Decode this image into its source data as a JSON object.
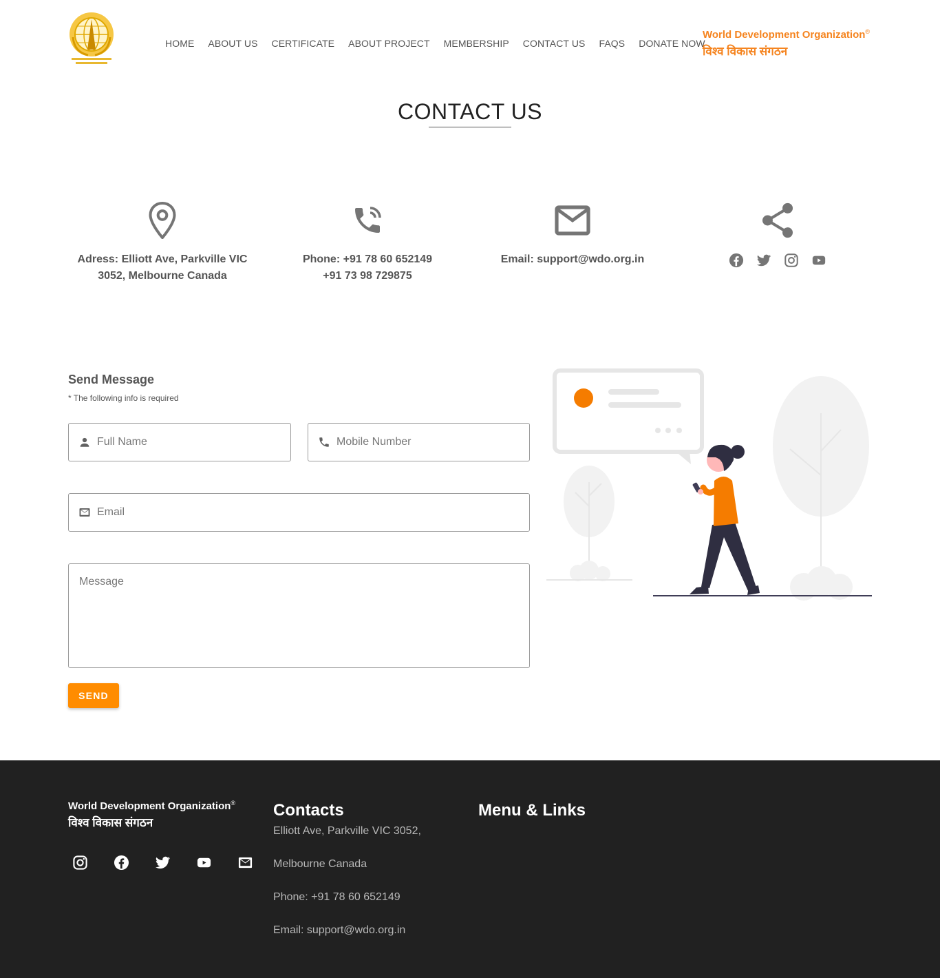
{
  "header": {
    "logo_alt": "World Development Organization",
    "nav": [
      "HOME",
      "ABOUT US",
      "CERTIFICATE",
      "ABOUT PROJECT",
      "MEMBERSHIP",
      "CONTACT US",
      "FAQS",
      "DONATE NOW"
    ],
    "brand_en": "World Development Organization",
    "brand_reg": "®",
    "brand_hi": "विश्व विकास संगठन"
  },
  "page": {
    "title": "CONTACT US"
  },
  "info": {
    "address_line1": "Adress: Elliott Ave, Parkville VIC",
    "address_line2": "3052, Melbourne Canada",
    "phone_line1": "Phone: +91 78 60 652149",
    "phone_line2": "+91 73 98 729875",
    "email": "Email: support@wdo.org.in",
    "social_icons": [
      "facebook-icon",
      "twitter-icon",
      "instagram-icon",
      "youtube-icon"
    ]
  },
  "form": {
    "title": "Send Message",
    "note": "* The following info is required",
    "name_placeholder": "Full Name",
    "mobile_placeholder": "Mobile Number",
    "email_placeholder": "Email",
    "message_placeholder": "Message",
    "send_label": "SEND"
  },
  "footer": {
    "brand_en": "World Development Organization",
    "brand_reg": "®",
    "brand_hi": "विश्व विकास संगठन",
    "social_icons": [
      "instagram-icon",
      "facebook-icon",
      "twitter-icon",
      "youtube-icon",
      "mail-icon"
    ],
    "contacts_heading": "Contacts",
    "contact_lines": [
      "Elliott Ave, Parkville VIC 3052,",
      "Melbourne Canada",
      "Phone: +91 78 60 652149",
      "Email: support@wdo.org.in"
    ],
    "menu_heading": "Menu & Links"
  },
  "colors": {
    "accent": "#f5841f",
    "button": "#ff8c00",
    "footer_bg": "#212121",
    "icon_gray": "#757575"
  }
}
